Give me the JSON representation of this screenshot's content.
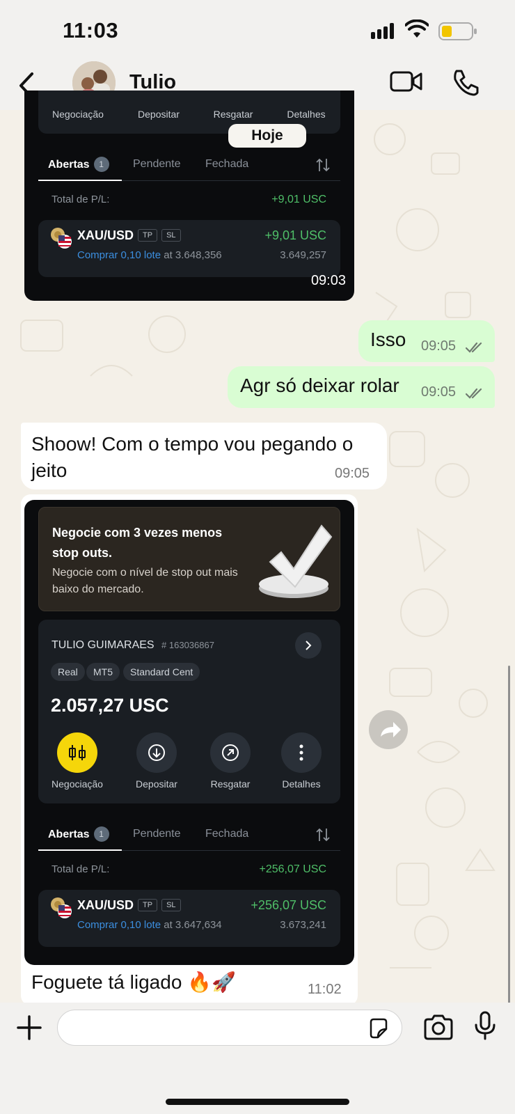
{
  "status_bar": {
    "time": "11:03"
  },
  "header": {
    "contact_name": "Tulio"
  },
  "date_chip": "Hoje",
  "card1": {
    "action_labels": [
      "Negociação",
      "Depositar",
      "Resgatar",
      "Detalhes"
    ],
    "tabs": {
      "open": "Abertas",
      "open_count": "1",
      "pending": "Pendente",
      "closed": "Fechada"
    },
    "total_label": "Total de P/L:",
    "total_value": "+9,01 USC",
    "position": {
      "symbol": "XAU/USD",
      "tp": "TP",
      "sl": "SL",
      "pl": "+9,01 USC",
      "side": "Comprar 0,10 lote",
      "at_text": "at 3.648,356",
      "current": "3.649,257"
    },
    "time": "09:03"
  },
  "messages": [
    {
      "text": "Isso",
      "time": "09:05"
    },
    {
      "text": "Agr só deixar rolar",
      "time": "09:05"
    },
    {
      "text": "Shoow! Com o tempo vou pegando o jeito",
      "time": "09:05"
    }
  ],
  "card2": {
    "promo_title": "Negocie com 3 vezes menos stop outs.",
    "promo_body": "Negocie com o nível de stop out mais baixo do mercado.",
    "account_name": "TULIO GUIMARAES",
    "account_number": "# 163036867",
    "chips": [
      "Real",
      "MT5",
      "Standard Cent"
    ],
    "balance": "2.057,27 USC",
    "actions": [
      "Negociação",
      "Depositar",
      "Resgatar",
      "Detalhes"
    ],
    "tabs": {
      "open": "Abertas",
      "open_count": "1",
      "pending": "Pendente",
      "closed": "Fechada"
    },
    "total_label": "Total de P/L:",
    "total_value": "+256,07 USC",
    "position": {
      "symbol": "XAU/USD",
      "tp": "TP",
      "sl": "SL",
      "pl": "+256,07 USC",
      "side": "Comprar 0,10 lote",
      "at_text": "at 3.647,634",
      "current": "3.673,241"
    },
    "caption": "Foguete tá ligado 🔥🚀",
    "time": "11:02"
  },
  "colors": {
    "outgoing_bubble": "#d9fdd3",
    "profit_green": "#4fbf68",
    "link_blue": "#3c8fe0",
    "trade_yellow": "#f5d60a"
  }
}
